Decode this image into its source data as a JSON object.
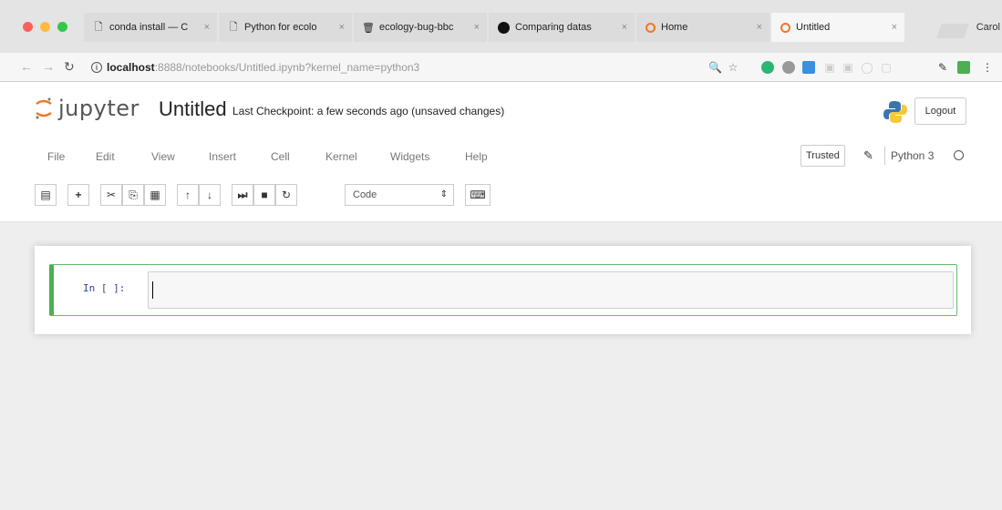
{
  "browser": {
    "tabs": [
      {
        "title": "conda install — C",
        "icon": "page-icon",
        "active": false
      },
      {
        "title": "Python for ecolo",
        "icon": "page-icon",
        "active": false
      },
      {
        "title": "ecology-bug-bbc",
        "icon": "trash-icon",
        "active": false
      },
      {
        "title": "Comparing datas",
        "icon": "github-icon",
        "active": false
      },
      {
        "title": "Home",
        "icon": "jupyter-icon",
        "active": false
      },
      {
        "title": "Untitled",
        "icon": "jupyter-icon",
        "active": true
      }
    ],
    "profile_name": "Carol",
    "url_host": "localhost",
    "url_rest": ":8888/notebooks/Untitled.ipynb?kernel_name=python3"
  },
  "jupyter": {
    "logo_text": "jupyter",
    "notebook_name": "Untitled",
    "checkpoint": "Last Checkpoint: a few seconds ago (unsaved changes)",
    "logout_label": "Logout",
    "menu": [
      "File",
      "Edit",
      "View",
      "Insert",
      "Cell",
      "Kernel",
      "Widgets",
      "Help"
    ],
    "trusted_label": "Trusted",
    "kernel_name": "Python 3",
    "cell_type": "Code",
    "toolbar_buttons": [
      {
        "name": "save-icon",
        "glyph": "🖫"
      },
      {
        "name": "add-cell-icon",
        "glyph": "+"
      },
      {
        "name": "cut-icon",
        "glyph": "✂"
      },
      {
        "name": "copy-icon",
        "glyph": "⎘"
      },
      {
        "name": "paste-icon",
        "glyph": "📋"
      },
      {
        "name": "move-up-icon",
        "glyph": "↑"
      },
      {
        "name": "move-down-icon",
        "glyph": "↓"
      },
      {
        "name": "run-icon",
        "glyph": "⏭"
      },
      {
        "name": "stop-icon",
        "glyph": "■"
      },
      {
        "name": "restart-icon",
        "glyph": "C"
      }
    ],
    "cells": [
      {
        "prompt": "In [ ]:",
        "source": ""
      }
    ]
  },
  "colors": {
    "cell_border": "#4caf50",
    "prompt": "#303f9f",
    "jupyter_orange": "#f37626"
  }
}
